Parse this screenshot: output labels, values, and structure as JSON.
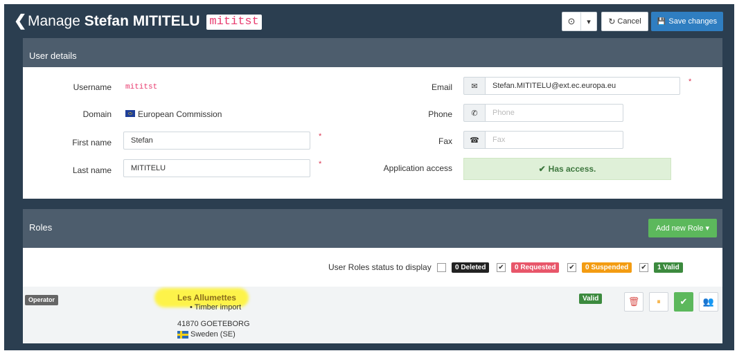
{
  "header": {
    "back_glyph": "❮",
    "title_prefix": "Manage",
    "user_full_name": "Stefan MITITELU",
    "user_login": "mititst",
    "history_icon": "clock-icon",
    "history_glyph": "⊙",
    "dropdown_glyph": "▾",
    "cancel_label": "Cancel",
    "cancel_glyph": "↻",
    "save_label": "Save changes",
    "save_glyph": "💾"
  },
  "user_details": {
    "section_title": "User details",
    "username_label": "Username",
    "username_value": "mititst",
    "domain_label": "Domain",
    "domain_value": "European Commission",
    "first_name_label": "First name",
    "first_name_value": "Stefan",
    "last_name_label": "Last name",
    "last_name_value": "MITITELU",
    "email_label": "Email",
    "email_value": "Stefan.MITITELU@ext.ec.europa.eu",
    "phone_label": "Phone",
    "phone_placeholder": "Phone",
    "fax_label": "Fax",
    "fax_placeholder": "Fax",
    "application_access_label": "Application access",
    "application_access_value": "Has access.",
    "required_mark": "*",
    "check_glyph": "✔",
    "email_glyph": "✉",
    "phone_glyph": "✆",
    "fax_glyph": "☎"
  },
  "roles": {
    "section_title": "Roles",
    "add_role_label": "Add new Role",
    "add_role_caret": "▾",
    "filter_label": "User Roles status to display",
    "check_glyph": "✔",
    "filters": [
      {
        "label": "0 Deleted",
        "checked": false,
        "color": "#222222"
      },
      {
        "label": "0 Requested",
        "checked": true,
        "color": "#e8566a"
      },
      {
        "label": "0 Suspended",
        "checked": true,
        "color": "#f39c12"
      },
      {
        "label": "1 Valid",
        "checked": true,
        "color": "#3c8a3e"
      }
    ],
    "items": [
      {
        "role_type": "Operator",
        "organisation": "Les Allumettes",
        "activity_bullet": "•",
        "activity": "Timber import",
        "address": "41870 GOETEBORG",
        "country": "Sweden (SE)",
        "status": "Valid",
        "actions": {
          "delete_glyph": "🗑",
          "suspend_glyph": "⏸",
          "validate_glyph": "✔",
          "users_glyph": "👥"
        }
      }
    ]
  },
  "colors": {
    "app_background": "#2b3e50",
    "panel_header": "#4d5d6d",
    "primary": "#2f7ec1",
    "success": "#5cb85c",
    "highlight": "#fdf34a",
    "login_pink": "#e83a6e"
  }
}
